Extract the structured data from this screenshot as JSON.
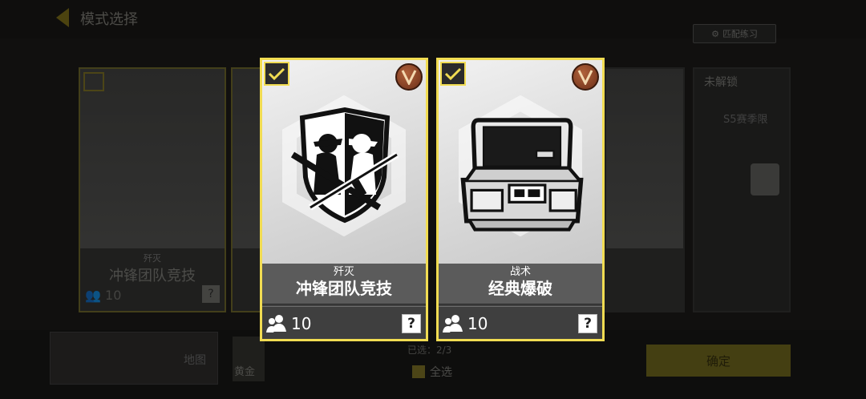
{
  "header": {
    "title": "模式选择",
    "practice_button": "匹配练习"
  },
  "cards": [
    {
      "category": "歼灭",
      "name": "冲锋团队竞技",
      "player_count": "10",
      "help_label": "?",
      "rank_badge": "V",
      "selected": true,
      "icon": "soldiers-crossed-rifles-shield-icon"
    },
    {
      "category": "战术",
      "name": "经典爆破",
      "player_count": "10",
      "help_label": "?",
      "rank_badge": "V",
      "selected": true,
      "icon": "bomb-suitcase-icon"
    }
  ],
  "background": {
    "left_card_category": "歼灭",
    "left_card_name": "冲锋团队竞技",
    "left_card_count": "10",
    "locked_title": "未解锁",
    "locked_sub": "S5赛季限",
    "map_label": "地图",
    "gold_label": "黄金",
    "selected_label": "已选：2/3",
    "select_all_label": "全选",
    "confirm_label": "确定"
  },
  "colors": {
    "accent_yellow": "#f1dc52",
    "rank_bronze": "#8e3f22",
    "card_info_bg": "#5b5b5b"
  }
}
